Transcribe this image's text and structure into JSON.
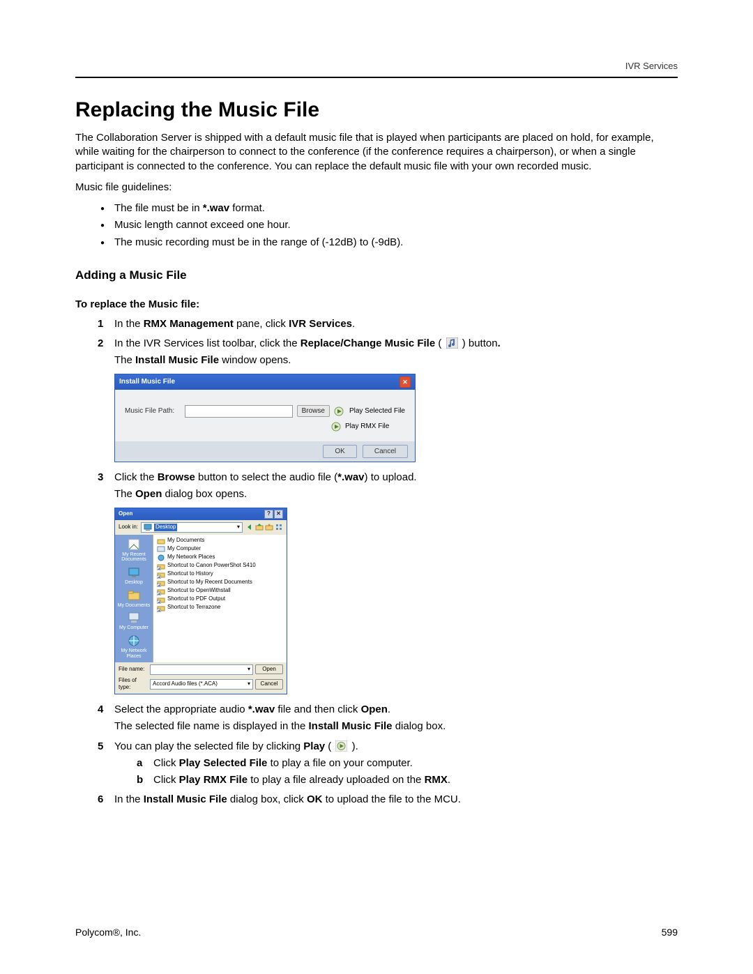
{
  "header": {
    "section": "IVR Services"
  },
  "title": "Replacing the Music File",
  "intro": "The Collaboration Server is shipped with a default music file that is played when participants are placed on hold, for example, while waiting for the chairperson to connect to the conference (if the conference requires a chairperson), or when a single participant is connected to the conference. You can replace the default music file with your own recorded music.",
  "guidelines_label": "Music file guidelines:",
  "guidelines": {
    "g0_a": "The file must be in ",
    "g0_b": "*.wav",
    "g0_c": " format.",
    "g1": "Music length cannot exceed one hour.",
    "g2": "The music recording must be in the range of (-12dB) to (-9dB)."
  },
  "adding_heading": "Adding a Music File",
  "to_replace": "To replace the Music file:",
  "steps": {
    "s1_a": "In the ",
    "s1_b": "RMX Management",
    "s1_c": " pane, click ",
    "s1_d": "IVR Services",
    "s1_e": ".",
    "s2_a": "In the IVR Services list toolbar, click the ",
    "s2_b": "Replace/Change Music File",
    "s2_c": " (",
    "s2_d": ") button",
    "s2_e": ".",
    "s2_f": "The ",
    "s2_g": "Install Music File",
    "s2_h": " window opens.",
    "s3_a": "Click the ",
    "s3_b": "Browse",
    "s3_c": " button to select the audio file (",
    "s3_d": "*.wav",
    "s3_e": ") to upload.",
    "s3_f": "The ",
    "s3_g": "Open",
    "s3_h": " dialog box opens.",
    "s4_a": "Select the appropriate audio ",
    "s4_b": "*.wav",
    "s4_c": " file and then click ",
    "s4_d": "Open",
    "s4_e": ".",
    "s4_f": "The selected file name is displayed in the ",
    "s4_g": "Install Music File",
    "s4_h": " dialog box.",
    "s5_a": "You can play the selected file by clicking ",
    "s5_b": "Play",
    "s5_c": " (",
    "s5_d": ").",
    "s5a_a": "Click ",
    "s5a_b": "Play Selected File",
    "s5a_c": " to play a file on your computer.",
    "s5b_a": "Click ",
    "s5b_b": "Play RMX File",
    "s5b_c": " to play a file already uploaded on the ",
    "s5b_d": "RMX",
    "s5b_e": ".",
    "s6_a": "In the ",
    "s6_b": "Install Music File",
    "s6_c": " dialog box, click ",
    "s6_d": "OK",
    "s6_e": " to upload the file to the MCU."
  },
  "install_dialog": {
    "title": "Install Music File",
    "label": "Music File Path:",
    "browse": "Browse",
    "play_selected": "Play Selected File",
    "play_rmx": "Play RMX File",
    "ok": "OK",
    "cancel": "Cancel"
  },
  "open_dialog": {
    "title": "Open",
    "lookin_label": "Look in:",
    "lookin_value": "Desktop",
    "sidebar": {
      "recent": "My Recent Documents",
      "desktop": "Desktop",
      "mydocs": "My Documents",
      "mycomp": "My Computer",
      "mynet": "My Network Places"
    },
    "files": {
      "f0": "My Documents",
      "f1": "My Computer",
      "f2": "My Network Places",
      "f3": "Shortcut to Canon PowerShot S410",
      "f4": "Shortcut to History",
      "f5": "Shortcut to My Recent Documents",
      "f6": "Shortcut to OpenWithstall",
      "f7": "Shortcut to PDF Output",
      "f8": "Shortcut to Terrazone"
    },
    "filename_label": "File name:",
    "filetype_label": "Files of type:",
    "filetype_value": "Accord Audio files (*.ACA)",
    "open_btn": "Open",
    "cancel_btn": "Cancel"
  },
  "footer": {
    "company": "Polycom®, Inc.",
    "page": "599"
  }
}
